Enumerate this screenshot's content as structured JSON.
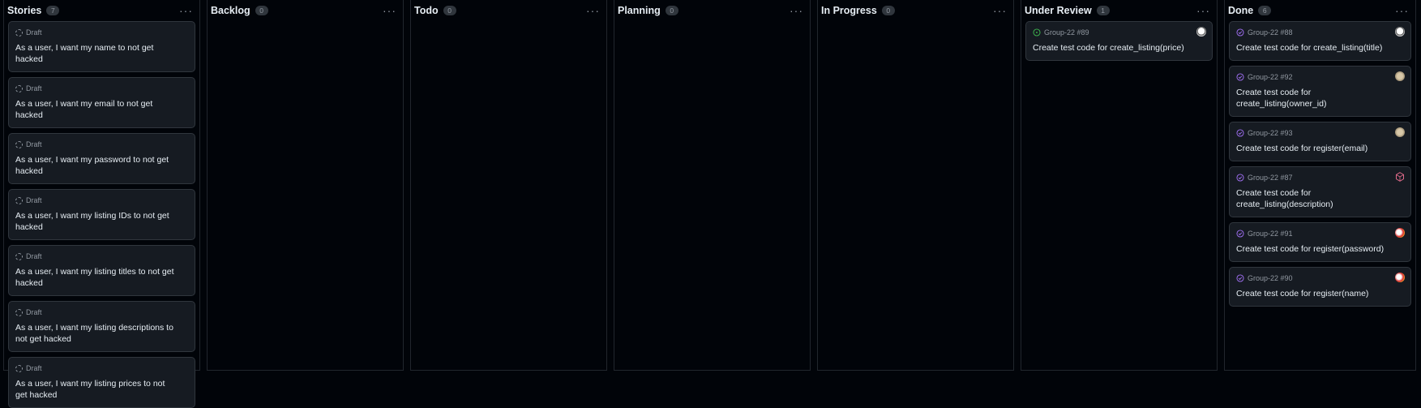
{
  "columns": [
    {
      "title": "Stories",
      "count": "7",
      "menu": "···",
      "cards": [
        {
          "type": "draft",
          "meta": "Draft",
          "title": "As a user, I want my name to not get hacked"
        },
        {
          "type": "draft",
          "meta": "Draft",
          "title": "As a user, I want my email to not get hacked"
        },
        {
          "type": "draft",
          "meta": "Draft",
          "title": "As a user, I want my password to not get hacked"
        },
        {
          "type": "draft",
          "meta": "Draft",
          "title": "As a user, I want my listing IDs to not get hacked"
        },
        {
          "type": "draft",
          "meta": "Draft",
          "title": "As a user, I want my listing titles to not get hacked"
        },
        {
          "type": "draft",
          "meta": "Draft",
          "title": "As a user, I want my listing descriptions to not get hacked"
        },
        {
          "type": "draft",
          "meta": "Draft",
          "title": "As a user, I want my listing prices to not get hacked"
        }
      ]
    },
    {
      "title": "Backlog",
      "count": "0",
      "menu": "···",
      "cards": []
    },
    {
      "title": "Todo",
      "count": "0",
      "menu": "···",
      "cards": []
    },
    {
      "title": "Planning",
      "count": "0",
      "menu": "···",
      "cards": []
    },
    {
      "title": "In Progress",
      "count": "0",
      "menu": "···",
      "cards": []
    },
    {
      "title": "Under Review",
      "count": "1",
      "menu": "···",
      "cards": [
        {
          "type": "open",
          "meta": "Group-22 #89",
          "title": "Create test code for create_listing(price)",
          "avatar": "av-white"
        }
      ]
    },
    {
      "title": "Done",
      "count": "6",
      "menu": "···",
      "cards": [
        {
          "type": "closed",
          "meta": "Group-22 #88",
          "title": "Create test code for create_listing(title)",
          "avatar": "av-white"
        },
        {
          "type": "closed",
          "meta": "Group-22 #92",
          "title": "Create test code for create_listing(owner_id)",
          "avatar": "av-tan"
        },
        {
          "type": "closed",
          "meta": "Group-22 #93",
          "title": "Create test code for register(email)",
          "avatar": "av-tan"
        },
        {
          "type": "closed",
          "meta": "Group-22 #87",
          "title": "Create test code for create_listing(description)",
          "avatar": "av-cube"
        },
        {
          "type": "closed",
          "meta": "Group-22 #91",
          "title": "Create test code for register(password)",
          "avatar": "av-red"
        },
        {
          "type": "closed",
          "meta": "Group-22 #90",
          "title": "Create test code for register(name)",
          "avatar": "av-red"
        }
      ]
    }
  ],
  "colors": {
    "background": "#010409",
    "card": "#161b22",
    "border": "#30363d",
    "text": "#e6edf3",
    "muted": "#9198a1",
    "open": "#3fb950",
    "done": "#a371f7"
  }
}
